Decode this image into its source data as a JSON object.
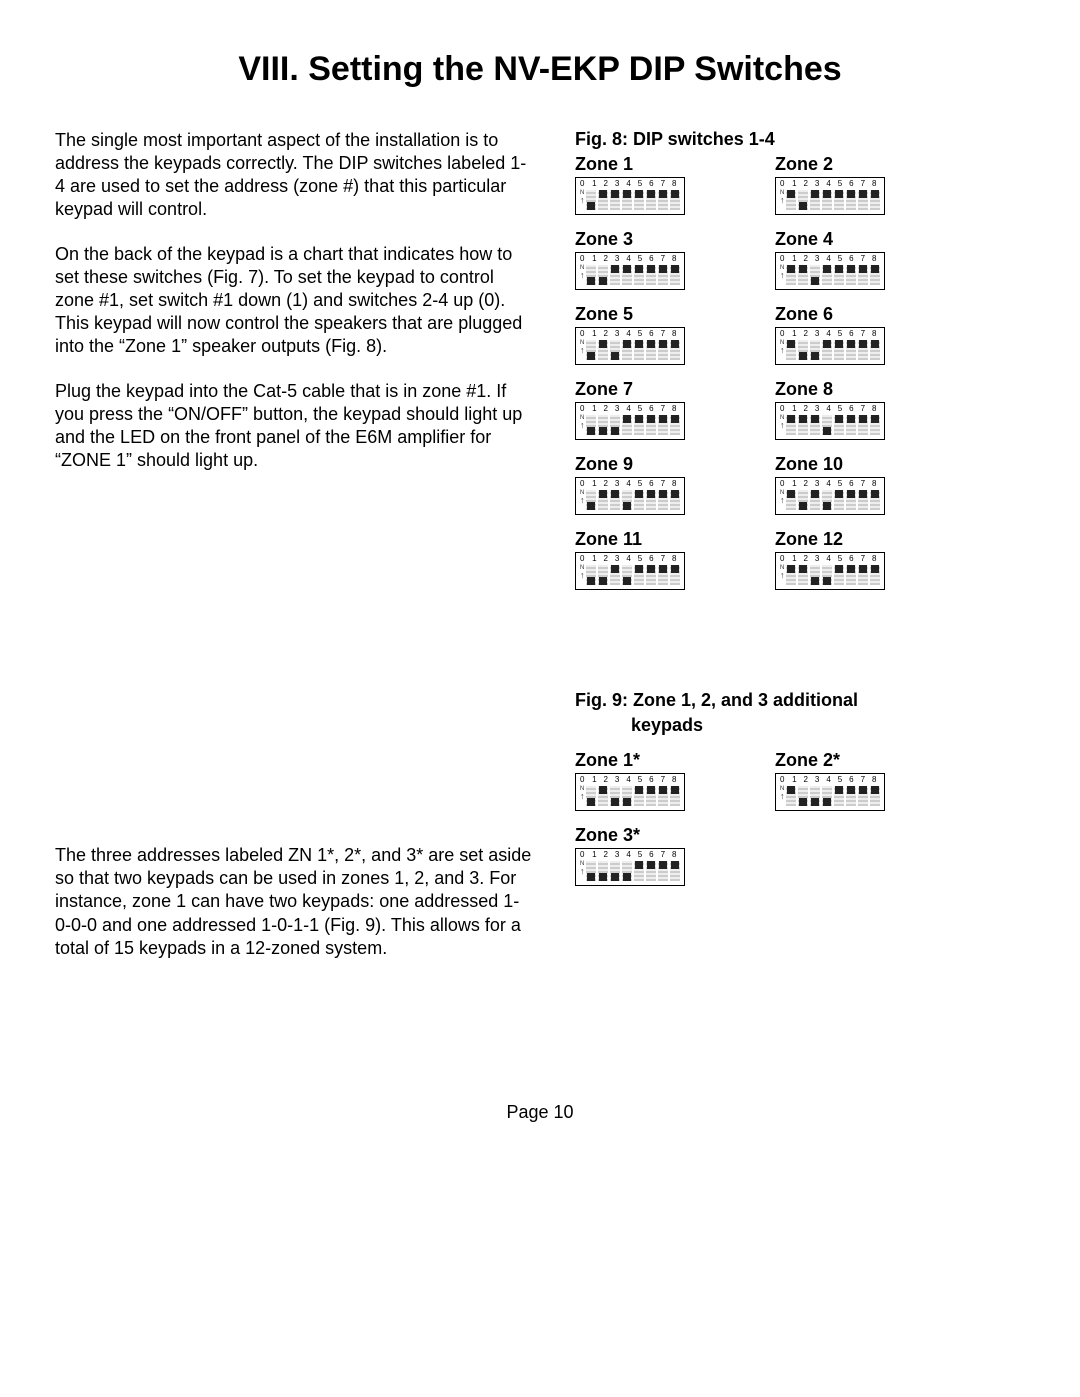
{
  "title": "VIII. Setting the NV-EKP DIP Switches",
  "body": {
    "p1": "The single most important aspect of the installation is to address the keypads correctly. The DIP switches labeled 1-4 are used to set the address (zone #) that this particular keypad will control.",
    "p2": "On the back of the keypad is a chart that indicates how to set these switches (Fig. 7). To set the keypad to control zone #1, set switch #1 down (1) and switches 2-4 up (0). This keypad will now control the speakers that are plugged into the “Zone 1” speaker outputs (Fig. 8).",
    "p3": "Plug the keypad into the Cat-5 cable that is in zone #1. If you press the “ON/OFF” button, the keypad should light up and the LED on the front panel of the E6M amplifier for “ZONE 1” should light up.",
    "p4": "The three addresses labeled ZN 1*, 2*, and 3* are set aside so that two keypads can be used in zones 1, 2, and 3. For instance, zone 1 can have two keypads: one addressed 1-0-0-0 and one addressed 1-0-1-1 (Fig. 9). This allows for a total of 15 keypads in a 12-zoned system."
  },
  "fig8": {
    "title": "Fig. 8: DIP switches 1-4",
    "zones": [
      {
        "label": "Zone 1",
        "sw": [
          1,
          0,
          0,
          0,
          0,
          0,
          0,
          0
        ]
      },
      {
        "label": "Zone 2",
        "sw": [
          0,
          1,
          0,
          0,
          0,
          0,
          0,
          0
        ]
      },
      {
        "label": "Zone 3",
        "sw": [
          1,
          1,
          0,
          0,
          0,
          0,
          0,
          0
        ]
      },
      {
        "label": "Zone 4",
        "sw": [
          0,
          0,
          1,
          0,
          0,
          0,
          0,
          0
        ]
      },
      {
        "label": "Zone 5",
        "sw": [
          1,
          0,
          1,
          0,
          0,
          0,
          0,
          0
        ]
      },
      {
        "label": "Zone 6",
        "sw": [
          0,
          1,
          1,
          0,
          0,
          0,
          0,
          0
        ]
      },
      {
        "label": "Zone 7",
        "sw": [
          1,
          1,
          1,
          0,
          0,
          0,
          0,
          0
        ]
      },
      {
        "label": "Zone 8",
        "sw": [
          0,
          0,
          0,
          1,
          0,
          0,
          0,
          0
        ]
      },
      {
        "label": "Zone 9",
        "sw": [
          1,
          0,
          0,
          1,
          0,
          0,
          0,
          0
        ]
      },
      {
        "label": "Zone 10",
        "sw": [
          0,
          1,
          0,
          1,
          0,
          0,
          0,
          0
        ]
      },
      {
        "label": "Zone 11",
        "sw": [
          1,
          1,
          0,
          1,
          0,
          0,
          0,
          0
        ]
      },
      {
        "label": "Zone 12",
        "sw": [
          0,
          0,
          1,
          1,
          0,
          0,
          0,
          0
        ]
      }
    ]
  },
  "fig9": {
    "title": "Fig. 9: Zone 1, 2, and 3 additional",
    "subtitle": "keypads",
    "zones": [
      {
        "label": "Zone 1*",
        "sw": [
          1,
          0,
          1,
          1,
          0,
          0,
          0,
          0
        ]
      },
      {
        "label": "Zone 2*",
        "sw": [
          0,
          1,
          1,
          1,
          0,
          0,
          0,
          0
        ]
      },
      {
        "label": "Zone 3*",
        "sw": [
          1,
          1,
          1,
          1,
          0,
          0,
          0,
          0
        ]
      }
    ]
  },
  "dip_numbers": [
    "0",
    "1",
    "2",
    "3",
    "4",
    "5",
    "6",
    "7",
    "8"
  ],
  "side_label": {
    "top": "N",
    "bottom": "↑"
  },
  "footer": "Page 10"
}
